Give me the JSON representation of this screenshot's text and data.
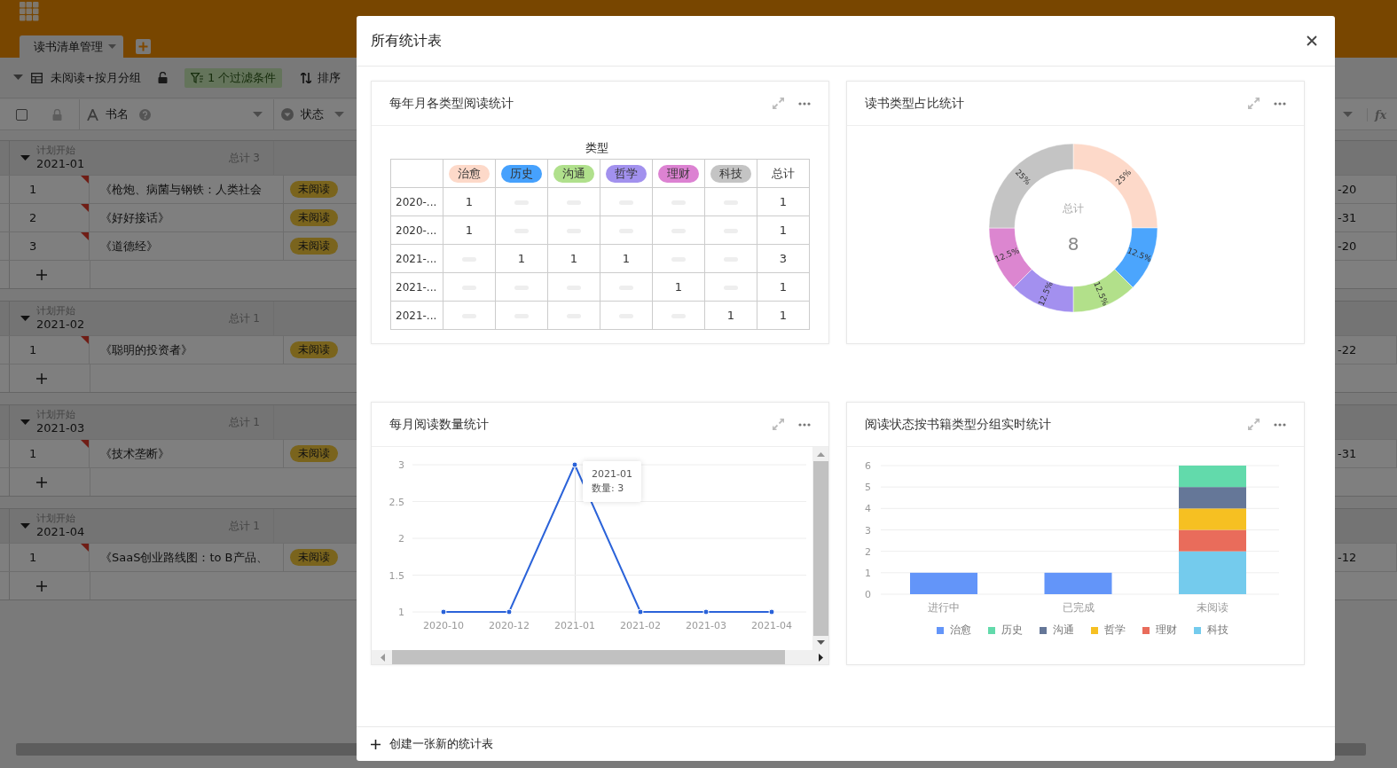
{
  "app": {
    "tab": "读书清单管理",
    "view": "未阅读+按月分组",
    "filter": "1 个过滤条件",
    "sort": "排序",
    "columns": [
      {
        "label": "书名"
      },
      {
        "label": "状态"
      }
    ],
    "formula_column": "fx",
    "select_all_checked": false
  },
  "groups": [
    {
      "field": "计划开始",
      "value": "2021-01",
      "total": "总计 3",
      "rows": [
        {
          "index": "1",
          "title": "《枪炮、病菌与钢铁：人类社会",
          "status": "未阅读",
          "date": "-20"
        },
        {
          "index": "2",
          "title": "《好好接话》",
          "status": "未阅读",
          "date": "-31"
        },
        {
          "index": "3",
          "title": "《道德经》",
          "status": "未阅读",
          "date": "-20"
        }
      ]
    },
    {
      "field": "计划开始",
      "value": "2021-02",
      "total": "总计 1",
      "rows": [
        {
          "index": "1",
          "title": "《聪明的投资者》",
          "status": "未阅读",
          "date": "-22"
        }
      ]
    },
    {
      "field": "计划开始",
      "value": "2021-03",
      "total": "总计 1",
      "rows": [
        {
          "index": "1",
          "title": "《技术垄断》",
          "status": "未阅读",
          "date": "-31"
        }
      ]
    },
    {
      "field": "计划开始",
      "value": "2021-04",
      "total": "总计 1",
      "rows": [
        {
          "index": "1",
          "title": "《SaaS创业路线图：to B产品、",
          "status": "未阅读",
          "date": "-12"
        }
      ]
    }
  ],
  "modal": {
    "title": "所有统计表",
    "footer": "创建一张新的统计表",
    "cards": [
      {
        "kind": "pivot",
        "title": "每年月各类型阅读统计",
        "header": "类型",
        "total_label": "总计",
        "columns": [
          {
            "label": "治愈",
            "color": "#fdd9c9"
          },
          {
            "label": "历史",
            "color": "#46a1fd"
          },
          {
            "label": "沟通",
            "color": "#b0e08c"
          },
          {
            "label": "哲学",
            "color": "#a291ee"
          },
          {
            "label": "理财",
            "color": "#dc82d2"
          },
          {
            "label": "科技",
            "color": "#c4c4c4"
          }
        ],
        "rows": [
          {
            "label": "2020-...",
            "cells": [
              "1",
              null,
              null,
              null,
              null,
              null
            ],
            "total": "1"
          },
          {
            "label": "2020-...",
            "cells": [
              "1",
              null,
              null,
              null,
              null,
              null
            ],
            "total": "1"
          },
          {
            "label": "2021-...",
            "cells": [
              null,
              "1",
              "1",
              "1",
              null,
              null
            ],
            "total": "3"
          },
          {
            "label": "2021-...",
            "cells": [
              null,
              null,
              null,
              null,
              "1",
              null
            ],
            "total": "1"
          },
          {
            "label": "2021-...",
            "cells": [
              null,
              null,
              null,
              null,
              null,
              "1"
            ],
            "total": "1"
          }
        ]
      },
      {
        "kind": "chart",
        "title": "读书类型占比统计",
        "center_label": "总计",
        "center_value": "8",
        "chart_data": {
          "type": "donut",
          "values": [
            25,
            12.5,
            12.5,
            12.5,
            12.5,
            25
          ],
          "colors": [
            "#fdd9c9",
            "#4ba5fd",
            "#b2e08a",
            "#a390ef",
            "#dc86d0",
            "#c4c4c4"
          ],
          "value_labels": [
            "25%",
            "12.5%",
            "12.5%",
            "12.5%",
            "12.5%",
            "25%"
          ]
        }
      },
      {
        "kind": "chart",
        "title": "每月阅读数量统计",
        "tooltip": {
          "title": "2021-01",
          "suffix": ": 3"
        },
        "chart_data": {
          "type": "line",
          "categories": [
            "2020-10",
            "2020-12",
            "2021-01",
            "2021-02",
            "2021-03",
            "2021-04"
          ],
          "series": [
            {
              "name": "数量",
              "color": "#2b63d9",
              "marker": true,
              "values": [
                1,
                1,
                3,
                1,
                1,
                1
              ]
            }
          ],
          "ylim": [
            1,
            3
          ],
          "yticks": [
            1,
            1.5,
            2,
            2.5,
            3
          ],
          "grid": true
        }
      },
      {
        "kind": "chart",
        "title": "阅读状态按书籍类型分组实时统计",
        "chart_data": {
          "type": "bar",
          "stacked": true,
          "grid": true,
          "legend": "bottom",
          "categories": [
            "进行中",
            "已完成",
            "未阅读"
          ],
          "ylim": [
            0,
            6
          ],
          "yticks": [
            0,
            1,
            2,
            3,
            4,
            5,
            6
          ],
          "series": [
            {
              "name": "治愈",
              "color": "#6395f9",
              "values": [
                1,
                1,
                0
              ]
            },
            {
              "name": "历史",
              "color": "#62daab",
              "values": [
                0,
                0,
                1
              ]
            },
            {
              "name": "沟通",
              "color": "#657798",
              "values": [
                0,
                0,
                1
              ]
            },
            {
              "name": "哲学",
              "color": "#f6c022",
              "values": [
                0,
                0,
                1
              ]
            },
            {
              "name": "理财",
              "color": "#e96c5b",
              "values": [
                0,
                0,
                1
              ]
            },
            {
              "name": "科技",
              "color": "#74cbed",
              "values": [
                0,
                0,
                2
              ]
            }
          ]
        }
      }
    ]
  }
}
